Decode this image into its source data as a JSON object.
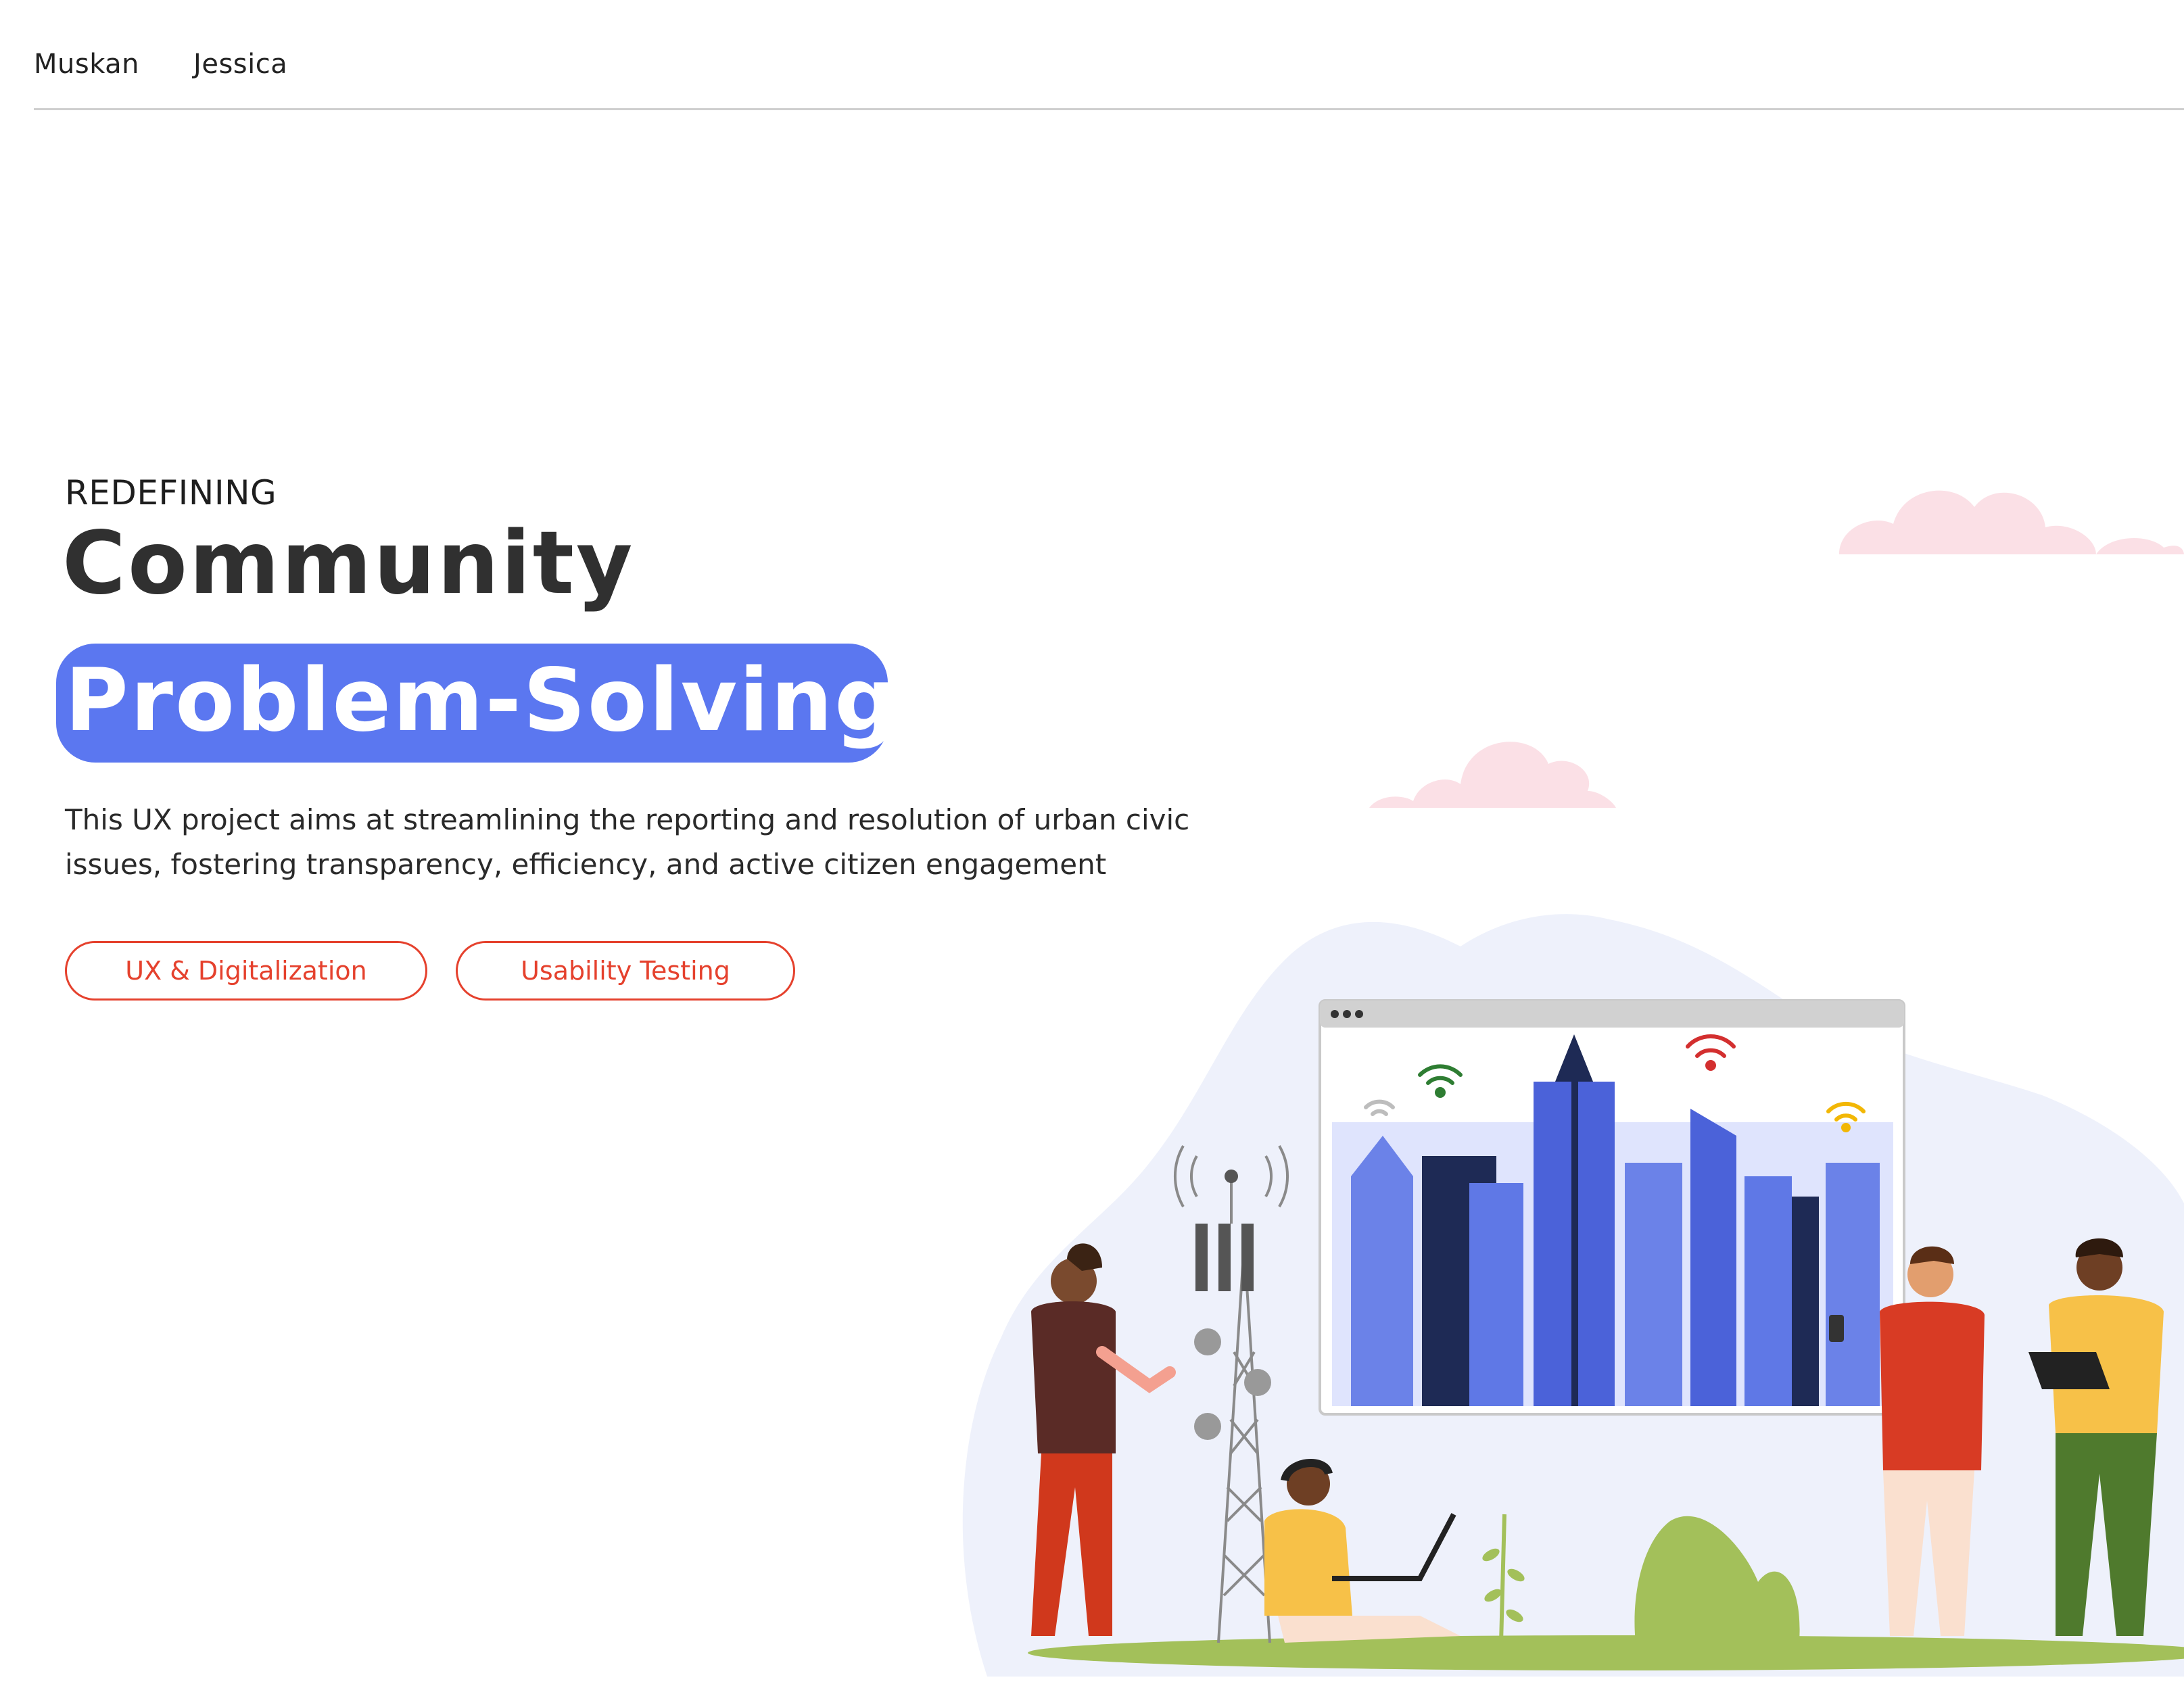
{
  "nav": {
    "links": [
      "Muskan",
      "Jessica"
    ]
  },
  "hero": {
    "eyebrow": "REDEFINING",
    "headline": "Community",
    "highlight": "Problem-Solving",
    "description": "This UX project aims at streamlining the reporting and resolution of urban civic issues, fostering transparency, efficiency, and active citizen engagement",
    "tags": [
      "UX & Digitalization",
      "Usability Testing"
    ]
  },
  "colors": {
    "accent_blue": "#5b77f0",
    "tag_red": "#e5412d",
    "cloud_pink": "#fbe0e6",
    "ground_green": "#a3c05a"
  },
  "illustration": {
    "icons": [
      "cloud-icon",
      "browser-window-icon",
      "city-skyline-icon",
      "wifi-icon",
      "cell-tower-icon",
      "person-icon",
      "laptop-icon",
      "phone-icon",
      "plant-icon"
    ]
  }
}
